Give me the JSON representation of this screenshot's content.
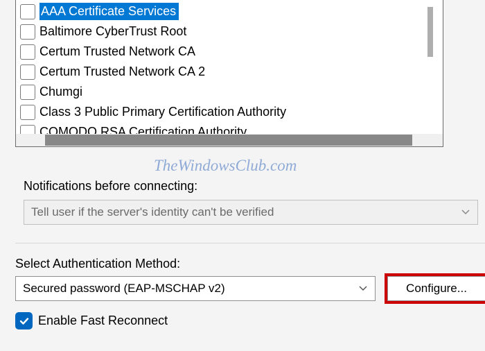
{
  "certificates": {
    "items": [
      {
        "label": "AAA Certificate Services",
        "checked": false,
        "selected": true
      },
      {
        "label": "Baltimore CyberTrust Root",
        "checked": false,
        "selected": false
      },
      {
        "label": "Certum Trusted Network CA",
        "checked": false,
        "selected": false
      },
      {
        "label": "Certum Trusted Network CA 2",
        "checked": false,
        "selected": false
      },
      {
        "label": "Chumgi",
        "checked": false,
        "selected": false
      },
      {
        "label": "Class 3 Public Primary Certification Authority",
        "checked": false,
        "selected": false
      },
      {
        "label": "COMODO RSA Certification Authority",
        "checked": false,
        "selected": false
      }
    ]
  },
  "notifications": {
    "label": "Notifications before connecting:",
    "selected": "Tell user if the server's identity can't be verified"
  },
  "auth": {
    "label": "Select Authentication Method:",
    "selected": "Secured password (EAP-MSCHAP v2)",
    "configure": "Configure..."
  },
  "fast_reconnect": {
    "label": "Enable Fast Reconnect",
    "checked": true
  },
  "watermark": "TheWindowsClub.com"
}
